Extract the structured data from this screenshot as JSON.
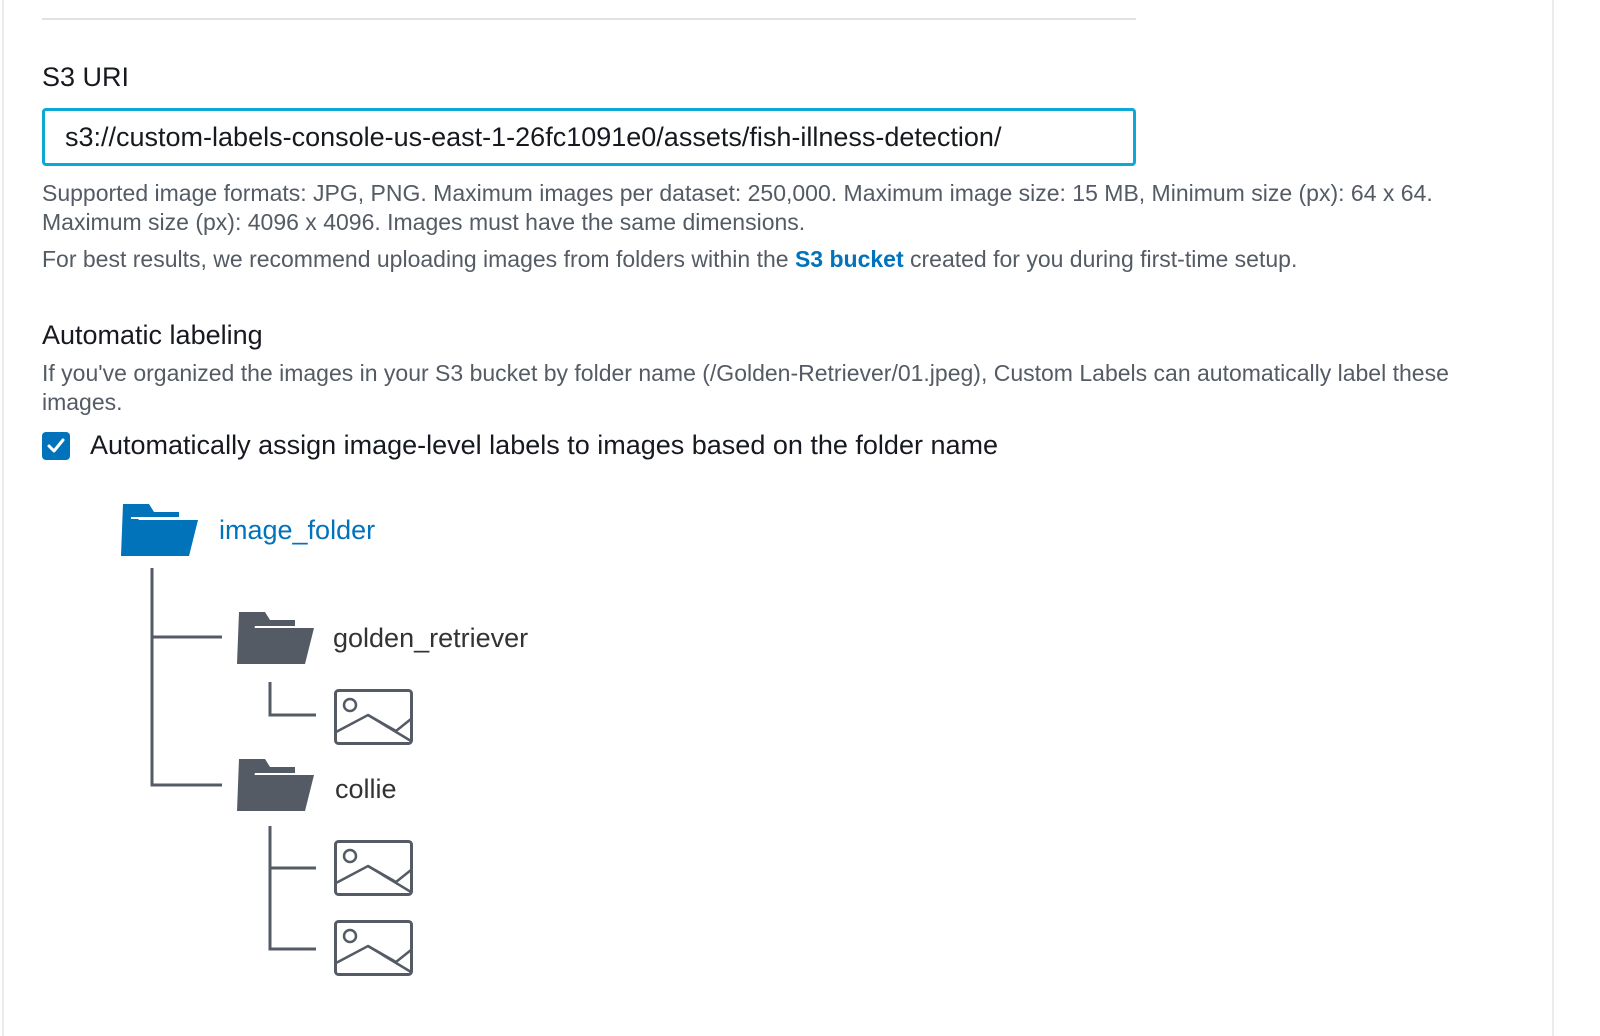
{
  "s3_uri": {
    "label": "S3 URI",
    "value": "s3://custom-labels-console-us-east-1-26fc1091e0/assets/fish-illness-detection/",
    "hint_formats": "Supported image formats: JPG, PNG. Maximum images per dataset: 250,000. Maximum image size: 15 MB, Minimum size (px): 64 x 64. Maximum size (px): 4096 x 4096. Images must have the same dimensions.",
    "hint_best_prefix": "For best results, we recommend uploading images from folders within the",
    "hint_best_link": "S3 bucket",
    "hint_best_suffix": "created for you during first-time setup."
  },
  "automatic_labeling": {
    "title": "Automatic labeling",
    "description": "If you've organized the images in your S3 bucket by folder name (/Golden-Retriever/01.jpeg), Custom Labels can automatically label these images.",
    "checkbox_label": "Automatically assign image-level labels to images based on the folder name",
    "checked": true
  },
  "folder_tree": {
    "root": "image_folder",
    "children": [
      {
        "name": "golden_retriever",
        "image_count": 1
      },
      {
        "name": "collie",
        "image_count": 2
      }
    ]
  },
  "colors": {
    "link": "#0073bb",
    "input_focus": "#0ca8d8",
    "folder_dark": "#545b64",
    "hint_text": "#545b64"
  },
  "icons": [
    "checkmark-icon",
    "folder-open-icon",
    "image-icon"
  ]
}
